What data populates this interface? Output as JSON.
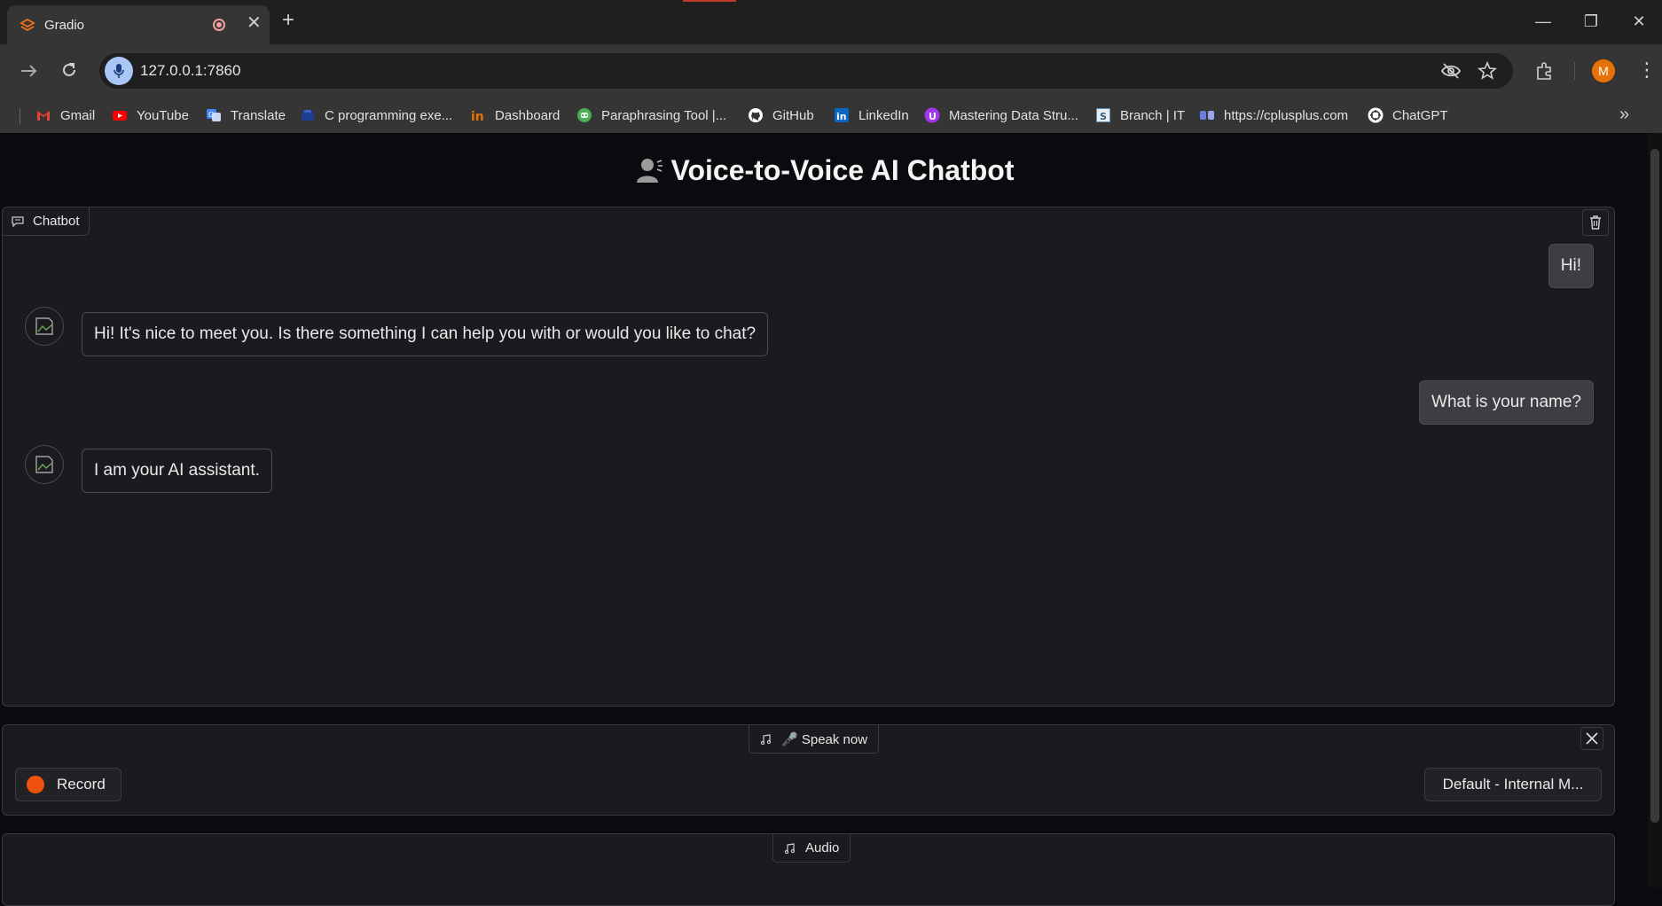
{
  "browser": {
    "tab_title": "Gradio",
    "tab_close_glyph": "✕",
    "new_tab_glyph": "+",
    "url": "127.0.0.1:7860",
    "profile_initial": "M",
    "window_controls": {
      "minimize": "—",
      "maximize": "❐",
      "close": "✕"
    },
    "bookmarks": [
      {
        "label": "Gmail",
        "icon": "gmail-icon",
        "color": "#ea4335"
      },
      {
        "label": "YouTube",
        "icon": "youtube-icon",
        "color": "#ff0000"
      },
      {
        "label": "Translate",
        "icon": "translate-icon",
        "color": "#4285f4"
      },
      {
        "label": "C programming exe...",
        "icon": "c-programming-icon",
        "color": "#1d3d8f"
      },
      {
        "label": "Dashboard",
        "icon": "dashboard-icon",
        "color": "#e37400"
      },
      {
        "label": "Paraphrasing Tool |...",
        "icon": "paraphrasing-icon",
        "color": "#4caf50"
      },
      {
        "label": "GitHub",
        "icon": "github-icon",
        "color": "#ffffff"
      },
      {
        "label": "LinkedIn",
        "icon": "linkedin-icon",
        "color": "#0a66c2"
      },
      {
        "label": "Mastering Data Stru...",
        "icon": "udemy-icon",
        "color": "#a435f0"
      },
      {
        "label": "Branch | IT",
        "icon": "branch-icon",
        "color": "#5f8fb3"
      },
      {
        "label": "https://cplusplus.com",
        "icon": "cplusplus-icon",
        "color": "#6b7ee0"
      },
      {
        "label": "ChatGPT",
        "icon": "chatgpt-icon",
        "color": "#ffffff"
      }
    ]
  },
  "app": {
    "title": "Voice-to-Voice AI Chatbot",
    "chatbot_label": "Chatbot",
    "messages": [
      {
        "role": "user",
        "text": "Hi!"
      },
      {
        "role": "bot",
        "text": "Hi! It's nice to meet you. Is there something I can help you with or would you like to chat?"
      },
      {
        "role": "user",
        "text": "What is your name?"
      },
      {
        "role": "bot",
        "text": "I am your AI assistant."
      }
    ],
    "input_audio": {
      "label": "🎤 Speak now",
      "record_label": "Record",
      "device": "Default - Internal M..."
    },
    "output_audio": {
      "label": "Audio"
    }
  },
  "colors": {
    "record_dot": "#f0530e",
    "page_bg": "#0b0b0f",
    "panel_bg": "#1b1b1f",
    "user_bubble": "#3d3d42"
  }
}
